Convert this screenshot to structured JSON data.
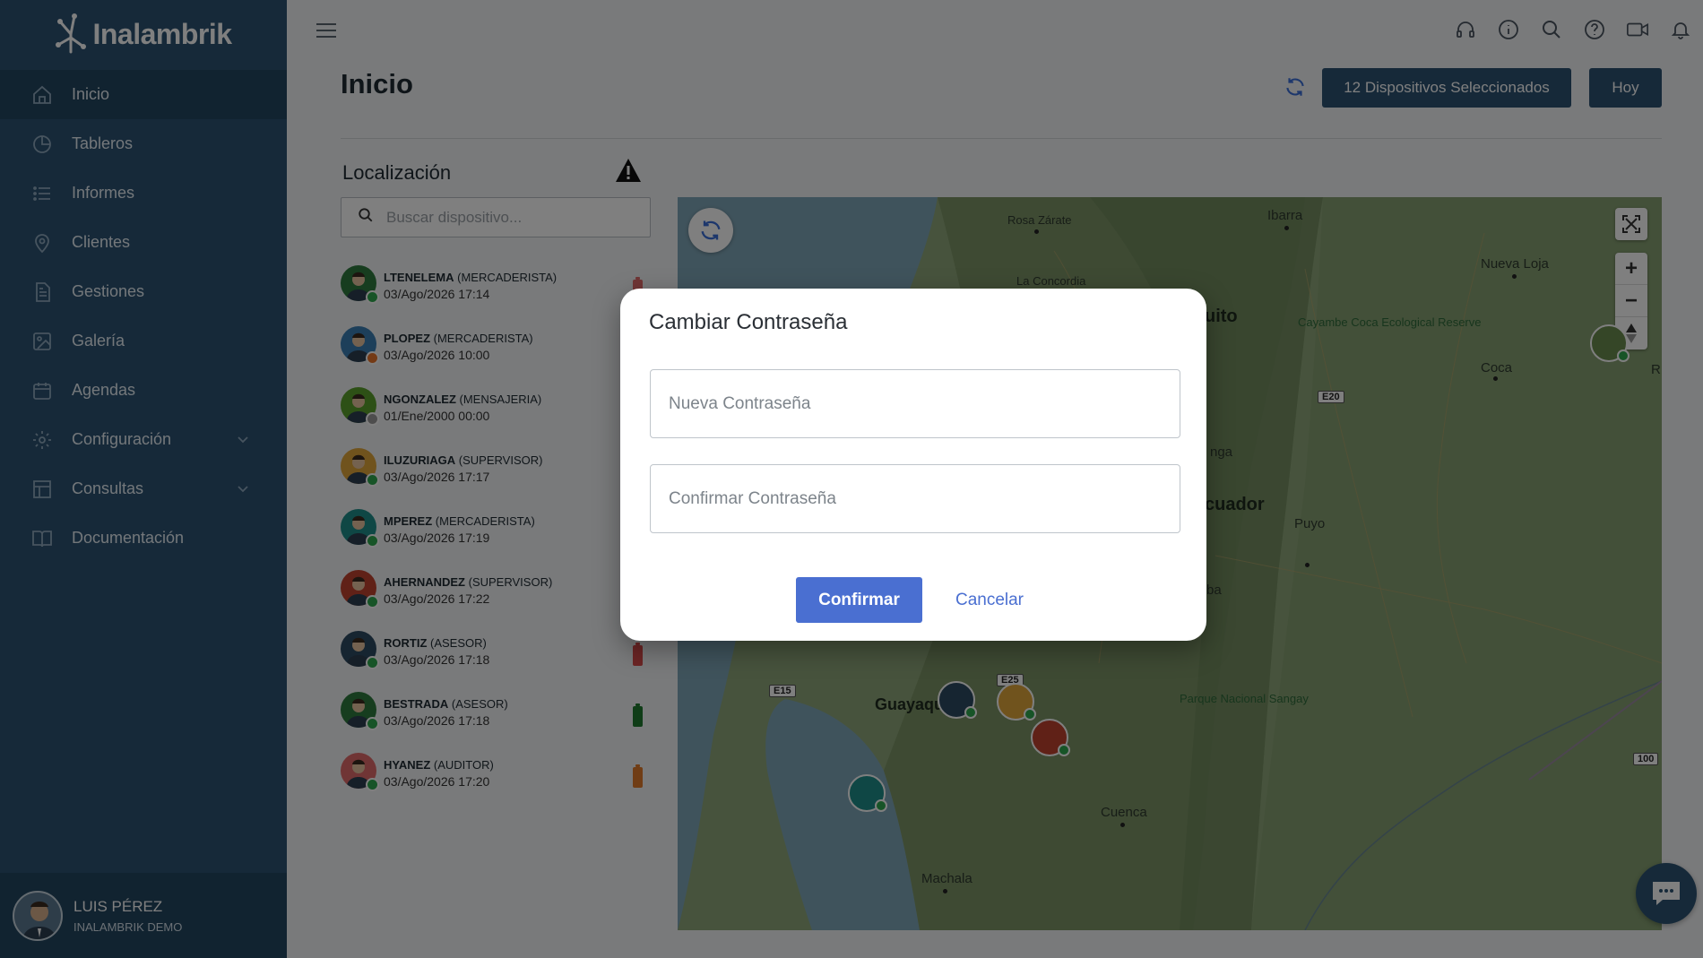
{
  "app": {
    "brand": "Inalambrik"
  },
  "sidebar": {
    "items": [
      {
        "label": "Inicio",
        "icon": "home-icon"
      },
      {
        "label": "Tableros",
        "icon": "pie-chart-icon"
      },
      {
        "label": "Informes",
        "icon": "list-icon"
      },
      {
        "label": "Clientes",
        "icon": "location-pin-icon"
      },
      {
        "label": "Gestiones",
        "icon": "document-icon"
      },
      {
        "label": "Galería",
        "icon": "image-icon"
      },
      {
        "label": "Agendas",
        "icon": "calendar-icon"
      },
      {
        "label": "Configuración",
        "icon": "gear-icon"
      },
      {
        "label": "Consultas",
        "icon": "table-icon"
      },
      {
        "label": "Documentación",
        "icon": "book-icon"
      }
    ],
    "user": {
      "name": "LUIS PÉREZ",
      "org": "INALAMBRIK DEMO"
    }
  },
  "header": {
    "title": "Inicio",
    "devices_button": "12 Dispositivos Seleccionados",
    "today_button": "Hoy"
  },
  "location": {
    "title": "Localización",
    "search_placeholder": "Buscar dispositivo...",
    "devices": [
      {
        "name": "LTENELEMA",
        "role": "(MERCADERISTA)",
        "time": "03/Ago/2026 17:14",
        "status": "#2fa84f",
        "battery": "#e06b6b",
        "skin": "#2f7a3e"
      },
      {
        "name": "PLOPEZ",
        "role": "(MERCADERISTA)",
        "time": "03/Ago/2026 10:00",
        "status": "#e8742b",
        "battery": "",
        "skin": "#3b7fb5"
      },
      {
        "name": "NGONZALEZ",
        "role": "(MENSAJERIA)",
        "time": "01/Ene/2000 00:00",
        "status": "#9a9a9a",
        "battery": "",
        "skin": "#5aa02c"
      },
      {
        "name": "ILUZURIAGA",
        "role": "(SUPERVISOR)",
        "time": "03/Ago/2026 17:17",
        "status": "#2fa84f",
        "battery": "",
        "skin": "#e0a63b"
      },
      {
        "name": "MPEREZ",
        "role": "(MERCADERISTA)",
        "time": "03/Ago/2026 17:19",
        "status": "#2fa84f",
        "battery": "",
        "skin": "#1f8f8a"
      },
      {
        "name": "AHERNANDEZ",
        "role": "(SUPERVISOR)",
        "time": "03/Ago/2026 17:22",
        "status": "#2fa84f",
        "battery": "",
        "skin": "#c0432f"
      },
      {
        "name": "RORTIZ",
        "role": "(ASESOR)",
        "time": "03/Ago/2026 17:18",
        "status": "#2fa84f",
        "battery": "#d94b4b",
        "skin": "#2c4a63"
      },
      {
        "name": "BESTRADA",
        "role": "(ASESOR)",
        "time": "03/Ago/2026 17:18",
        "status": "#2fa84f",
        "battery": "#1f7a2e",
        "skin": "#2f7a3e"
      },
      {
        "name": "HYANEZ",
        "role": "(AUDITOR)",
        "time": "03/Ago/2026 17:20",
        "status": "#2fa84f",
        "battery": "#e07a2b",
        "skin": "#e06b6b"
      }
    ]
  },
  "map": {
    "labels": [
      {
        "text": "Rosa Zárate"
      },
      {
        "text": "Ibarra"
      },
      {
        "text": "Nueva Loja"
      },
      {
        "text": "La Concordia"
      },
      {
        "text": "uito"
      },
      {
        "text": "Cayambe Coca Ecological Reserve"
      },
      {
        "text": "Coca"
      },
      {
        "text": "nga"
      },
      {
        "text": "cuador"
      },
      {
        "text": "Puyo"
      },
      {
        "text": "ba"
      },
      {
        "text": "Guayaqu"
      },
      {
        "text": "Parque Nacional Sangay"
      },
      {
        "text": "Cuenca"
      },
      {
        "text": "Machala"
      },
      {
        "text": "R"
      }
    ],
    "shields": [
      "E20",
      "E15",
      "E25",
      "100"
    ]
  },
  "modal": {
    "title": "Cambiar Contraseña",
    "new_password_placeholder": "Nueva Contraseña",
    "confirm_password_placeholder": "Confirmar Contraseña",
    "confirm_label": "Confirmar",
    "cancel_label": "Cancelar"
  }
}
